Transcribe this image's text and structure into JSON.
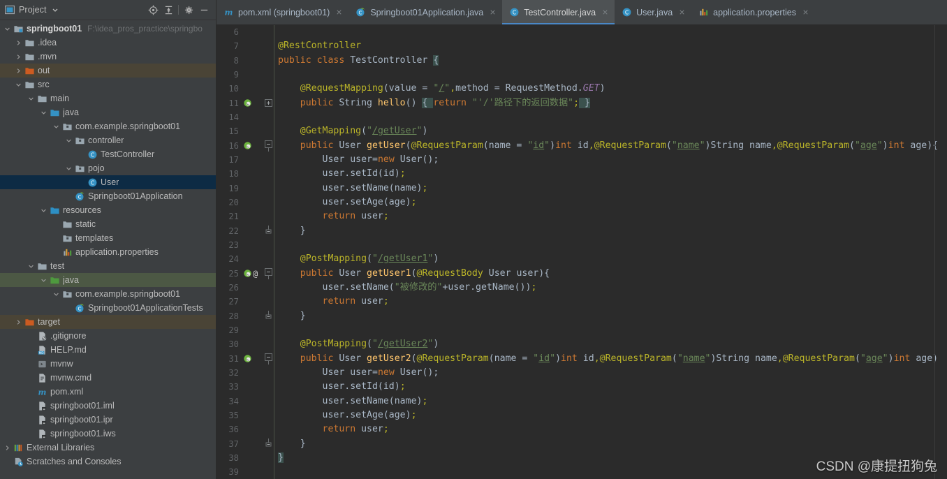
{
  "panel": {
    "title": "Project",
    "dropdown_icon": "chevron-down-icon",
    "actions": [
      {
        "name": "locate-icon",
        "label": "Select Opened File"
      },
      {
        "name": "collapse-all-icon",
        "label": "Collapse All"
      },
      {
        "name": "gear-icon",
        "label": "Settings"
      },
      {
        "name": "minimize-icon",
        "label": "Hide"
      }
    ]
  },
  "tree": [
    {
      "label": "springboot01",
      "path": "F:\\idea_pros_practice\\springbo",
      "icon": "module-folder-icon",
      "indent": 0,
      "arrow": "down",
      "bold": true,
      "state": "normal"
    },
    {
      "label": ".idea",
      "path": "",
      "icon": "folder-icon",
      "indent": 1,
      "arrow": "right",
      "bold": false,
      "state": "normal"
    },
    {
      "label": ".mvn",
      "path": "",
      "icon": "folder-icon",
      "indent": 1,
      "arrow": "right",
      "bold": false,
      "state": "normal"
    },
    {
      "label": "out",
      "path": "",
      "icon": "folder-orange-icon",
      "indent": 1,
      "arrow": "right",
      "bold": false,
      "state": "brown"
    },
    {
      "label": "src",
      "path": "",
      "icon": "folder-icon",
      "indent": 1,
      "arrow": "down",
      "bold": false,
      "state": "normal"
    },
    {
      "label": "main",
      "path": "",
      "icon": "folder-icon",
      "indent": 2,
      "arrow": "down",
      "bold": false,
      "state": "normal"
    },
    {
      "label": "java",
      "path": "",
      "icon": "source-root-icon",
      "indent": 3,
      "arrow": "down",
      "bold": false,
      "state": "normal"
    },
    {
      "label": "com.example.springboot01",
      "path": "",
      "icon": "package-icon",
      "indent": 4,
      "arrow": "down",
      "bold": false,
      "state": "normal"
    },
    {
      "label": "controller",
      "path": "",
      "icon": "package-icon",
      "indent": 5,
      "arrow": "down",
      "bold": false,
      "state": "normal"
    },
    {
      "label": "TestController",
      "path": "",
      "icon": "java-class-icon",
      "indent": 6,
      "arrow": "none",
      "bold": false,
      "state": "normal"
    },
    {
      "label": "pojo",
      "path": "",
      "icon": "package-icon",
      "indent": 5,
      "arrow": "down",
      "bold": false,
      "state": "normal"
    },
    {
      "label": "User",
      "path": "",
      "icon": "java-class-icon",
      "indent": 6,
      "arrow": "none",
      "bold": false,
      "state": "selected"
    },
    {
      "label": "Springboot01Application",
      "path": "",
      "icon": "spring-class-icon",
      "indent": 5,
      "arrow": "none",
      "bold": false,
      "state": "normal"
    },
    {
      "label": "resources",
      "path": "",
      "icon": "resource-root-icon",
      "indent": 3,
      "arrow": "down",
      "bold": false,
      "state": "normal"
    },
    {
      "label": "static",
      "path": "",
      "icon": "folder-icon",
      "indent": 4,
      "arrow": "none",
      "bold": false,
      "state": "normal"
    },
    {
      "label": "templates",
      "path": "",
      "icon": "package-icon",
      "indent": 4,
      "arrow": "none",
      "bold": false,
      "state": "normal"
    },
    {
      "label": "application.properties",
      "path": "",
      "icon": "properties-file-icon",
      "indent": 4,
      "arrow": "none",
      "bold": false,
      "state": "normal"
    },
    {
      "label": "test",
      "path": "",
      "icon": "folder-icon",
      "indent": 2,
      "arrow": "down",
      "bold": false,
      "state": "normal"
    },
    {
      "label": "java",
      "path": "",
      "icon": "test-source-root-icon",
      "indent": 3,
      "arrow": "down",
      "bold": false,
      "state": "green"
    },
    {
      "label": "com.example.springboot01",
      "path": "",
      "icon": "package-icon",
      "indent": 4,
      "arrow": "down",
      "bold": false,
      "state": "normal"
    },
    {
      "label": "Springboot01ApplicationTests",
      "path": "",
      "icon": "spring-class-icon",
      "indent": 5,
      "arrow": "none",
      "bold": false,
      "state": "normal"
    },
    {
      "label": "target",
      "path": "",
      "icon": "folder-orange-icon",
      "indent": 1,
      "arrow": "right",
      "bold": false,
      "state": "brown"
    },
    {
      "label": ".gitignore",
      "path": "",
      "icon": "gitignore-file-icon",
      "indent": 2,
      "arrow": "none",
      "bold": false,
      "state": "normal"
    },
    {
      "label": "HELP.md",
      "path": "",
      "icon": "markdown-file-icon",
      "indent": 2,
      "arrow": "none",
      "bold": false,
      "state": "normal"
    },
    {
      "label": "mvnw",
      "path": "",
      "icon": "script-file-icon",
      "indent": 2,
      "arrow": "none",
      "bold": false,
      "state": "normal"
    },
    {
      "label": "mvnw.cmd",
      "path": "",
      "icon": "cmd-file-icon",
      "indent": 2,
      "arrow": "none",
      "bold": false,
      "state": "normal"
    },
    {
      "label": "pom.xml",
      "path": "",
      "icon": "maven-file-icon",
      "indent": 2,
      "arrow": "none",
      "bold": false,
      "state": "normal"
    },
    {
      "label": "springboot01.iml",
      "path": "",
      "icon": "iml-file-icon",
      "indent": 2,
      "arrow": "none",
      "bold": false,
      "state": "normal"
    },
    {
      "label": "springboot01.ipr",
      "path": "",
      "icon": "iml-file-icon",
      "indent": 2,
      "arrow": "none",
      "bold": false,
      "state": "normal"
    },
    {
      "label": "springboot01.iws",
      "path": "",
      "icon": "iml-file-icon",
      "indent": 2,
      "arrow": "none",
      "bold": false,
      "state": "normal"
    },
    {
      "label": "External Libraries",
      "path": "",
      "icon": "libraries-icon",
      "indent": 0,
      "arrow": "right",
      "bold": false,
      "state": "normal"
    },
    {
      "label": "Scratches and Consoles",
      "path": "",
      "icon": "scratches-icon",
      "indent": 0,
      "arrow": "none",
      "bold": false,
      "state": "normal"
    }
  ],
  "tabs": [
    {
      "label": "pom.xml (springboot01)",
      "icon": "maven-file-icon",
      "active": false,
      "close_icon": "close-icon"
    },
    {
      "label": "Springboot01Application.java",
      "icon": "spring-class-icon",
      "active": false,
      "close_icon": "close-icon"
    },
    {
      "label": "TestController.java",
      "icon": "java-class-icon",
      "active": true,
      "close_icon": "close-icon"
    },
    {
      "label": "User.java",
      "icon": "java-class-icon",
      "active": false,
      "close_icon": "close-icon"
    },
    {
      "label": "application.properties",
      "icon": "properties-file-icon",
      "active": false,
      "close_icon": "close-icon"
    }
  ],
  "code_lines": [
    {
      "num": "6",
      "gutter": [],
      "fold": "",
      "html": ""
    },
    {
      "num": "7",
      "gutter": [],
      "fold": "",
      "html": "<span class='ann'>@RestController</span>"
    },
    {
      "num": "8",
      "gutter": [],
      "fold": "",
      "html": "<span class='kw'>public class </span><span class='cls'>TestController </span><span class='brace-hl'>{</span>"
    },
    {
      "num": "9",
      "gutter": [],
      "fold": "",
      "html": ""
    },
    {
      "num": "10",
      "gutter": [],
      "fold": "",
      "html": "    <span class='ann'>@RequestMapping</span><span class='pun'>(value = </span><span class='str'>\"</span><span class='strl'>/</span><span class='str'>\"</span><span class='ann'>,</span><span class='pun'>method = RequestMethod.</span><span class='stat'>GET</span><span class='pun'>)</span>"
    },
    {
      "num": "11",
      "gutter": [
        "spring-bean-icon"
      ],
      "fold": "plus",
      "html": "    <span class='kw'>public </span><span class='cls'>String </span><span class='fn'>hello</span><span class='pun'>() </span><span class='brace-hl'>{ </span><span class='kw'>return </span><span class='str'>\"'/'路径下的返回数据\"</span><span class='ann'>;</span><span class='brace-hl'> }</span>"
    },
    {
      "num": "14",
      "gutter": [],
      "fold": "",
      "html": ""
    },
    {
      "num": "15",
      "gutter": [],
      "fold": "",
      "html": "    <span class='ann'>@GetMapping</span><span class='pun'>(</span><span class='str'>\"</span><span class='strl'>/getUser</span><span class='str'>\"</span><span class='pun'>)</span>"
    },
    {
      "num": "16",
      "gutter": [
        "spring-bean-icon"
      ],
      "fold": "minus",
      "html": "    <span class='kw'>public </span><span class='cls'>User </span><span class='fn'>getUser</span><span class='pun'>(</span><span class='ann'>@RequestParam</span><span class='pun'>(name = </span><span class='str'>\"</span><span class='strl'>id</span><span class='str'>\"</span><span class='pun'>)</span><span class='kw'>int </span><span class='pun'>id</span><span class='ann'>,</span><span class='ann'>@RequestParam</span><span class='pun'>(</span><span class='str'>\"</span><span class='strl'>name</span><span class='str'>\"</span><span class='pun'>)String name</span><span class='ann'>,</span><span class='ann'>@RequestParam</span><span class='pun'>(</span><span class='str'>\"</span><span class='strl'>age</span><span class='str'>\"</span><span class='pun'>)</span><span class='kw'>int </span><span class='pun'>age){</span>"
    },
    {
      "num": "17",
      "gutter": [],
      "fold": "",
      "html": "        <span class='pun'>User user=</span><span class='kw'>new </span><span class='pun'>User();</span>"
    },
    {
      "num": "18",
      "gutter": [],
      "fold": "",
      "html": "        <span class='pun'>user.setId(id)</span><span class='ann'>;</span>"
    },
    {
      "num": "19",
      "gutter": [],
      "fold": "",
      "html": "        <span class='pun'>user.setName(name)</span><span class='ann'>;</span>"
    },
    {
      "num": "20",
      "gutter": [],
      "fold": "",
      "html": "        <span class='pun'>user.setAge(age)</span><span class='ann'>;</span>"
    },
    {
      "num": "21",
      "gutter": [],
      "fold": "",
      "html": "        <span class='kw'>return </span><span class='pun'>user</span><span class='ann'>;</span>"
    },
    {
      "num": "22",
      "gutter": [],
      "fold": "end",
      "html": "    <span class='pun'>}</span>"
    },
    {
      "num": "23",
      "gutter": [],
      "fold": "",
      "html": ""
    },
    {
      "num": "24",
      "gutter": [],
      "fold": "",
      "html": "    <span class='ann'>@PostMapping</span><span class='pun'>(</span><span class='str'>\"</span><span class='strl'>/getUser1</span><span class='str'>\"</span><span class='pun'>)</span>"
    },
    {
      "num": "25",
      "gutter": [
        "spring-bean-icon",
        "at-icon"
      ],
      "fold": "minus",
      "html": "    <span class='kw'>public </span><span class='cls'>User </span><span class='fn'>getUser1</span><span class='pun'>(</span><span class='ann'>@RequestBody </span><span class='pun'>User user){</span>"
    },
    {
      "num": "26",
      "gutter": [],
      "fold": "",
      "html": "        <span class='pun'>user.setName(</span><span class='str'>\"被修改的\"</span><span class='pun'>+user.getName())</span><span class='ann'>;</span>"
    },
    {
      "num": "27",
      "gutter": [],
      "fold": "",
      "html": "        <span class='kw'>return </span><span class='pun'>user</span><span class='ann'>;</span>"
    },
    {
      "num": "28",
      "gutter": [],
      "fold": "end",
      "html": "    <span class='pun'>}</span>"
    },
    {
      "num": "29",
      "gutter": [],
      "fold": "",
      "html": ""
    },
    {
      "num": "30",
      "gutter": [],
      "fold": "",
      "html": "    <span class='ann'>@PostMapping</span><span class='pun'>(</span><span class='str'>\"</span><span class='strl'>/getUser2</span><span class='str'>\"</span><span class='pun'>)</span>"
    },
    {
      "num": "31",
      "gutter": [
        "spring-bean-icon"
      ],
      "fold": "minus",
      "html": "    <span class='kw'>public </span><span class='cls'>User </span><span class='fn'>getUser2</span><span class='pun'>(</span><span class='ann'>@RequestParam</span><span class='pun'>(name = </span><span class='str'>\"</span><span class='strl'>id</span><span class='str'>\"</span><span class='pun'>)</span><span class='kw'>int </span><span class='pun'>id</span><span class='ann'>,</span><span class='ann'>@RequestParam</span><span class='pun'>(</span><span class='str'>\"</span><span class='strl'>name</span><span class='str'>\"</span><span class='pun'>)String name</span><span class='ann'>,</span><span class='ann'>@RequestParam</span><span class='pun'>(</span><span class='str'>\"</span><span class='strl'>age</span><span class='str'>\"</span><span class='pun'>)</span><span class='kw'>int </span><span class='pun'>age){</span>"
    },
    {
      "num": "32",
      "gutter": [],
      "fold": "",
      "html": "        <span class='pun'>User user=</span><span class='kw'>new </span><span class='pun'>User();</span>"
    },
    {
      "num": "33",
      "gutter": [],
      "fold": "",
      "html": "        <span class='pun'>user.setId(id)</span><span class='ann'>;</span>"
    },
    {
      "num": "34",
      "gutter": [],
      "fold": "",
      "html": "        <span class='pun'>user.setName(name)</span><span class='ann'>;</span>"
    },
    {
      "num": "35",
      "gutter": [],
      "fold": "",
      "html": "        <span class='pun'>user.setAge(age)</span><span class='ann'>;</span>"
    },
    {
      "num": "36",
      "gutter": [],
      "fold": "",
      "html": "        <span class='kw'>return </span><span class='pun'>user</span><span class='ann'>;</span>"
    },
    {
      "num": "37",
      "gutter": [],
      "fold": "end",
      "html": "    <span class='pun'>}</span>"
    },
    {
      "num": "38",
      "gutter": [],
      "fold": "",
      "html": "<span class='brace-hl'>}</span>"
    },
    {
      "num": "39",
      "gutter": [],
      "fold": "",
      "html": ""
    }
  ],
  "watermark": "CSDN @康提扭狗兔",
  "colors": {
    "editor_bg": "#2b2b2b",
    "panel_bg": "#3c3f41",
    "accent": "#4a88c7",
    "selection": "#0d2b44",
    "keyword": "#cc7832",
    "annotation": "#bbb529",
    "string": "#6a8759",
    "method": "#ffc66d",
    "static_field": "#9876aa",
    "default_text": "#a9b7c6"
  }
}
